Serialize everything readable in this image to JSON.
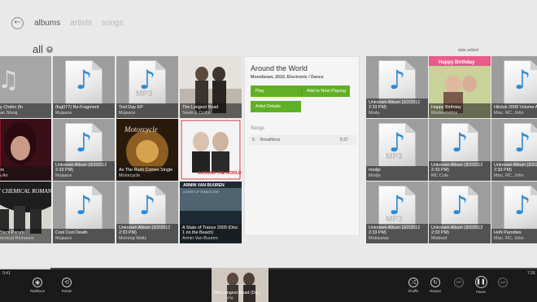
{
  "header": {
    "tabs": [
      {
        "label": "albums",
        "active": true
      },
      {
        "label": "artists",
        "active": false
      },
      {
        "label": "songs",
        "active": false
      }
    ],
    "filter": "all",
    "sort_label": "date added"
  },
  "tiles_left": [
    {
      "title": "...say Chaho (fo",
      "artist": "...Jaan Sheaj",
      "style": "faded"
    },
    {
      "title": "(fug077) Re-Fragment",
      "artist": "Mujaace",
      "style": "doc"
    },
    {
      "title": "Tool Day EP",
      "artist": "Mujaace",
      "style": "doc-mp3"
    },
    {
      "title": "The Longest Road",
      "artist": "Seals & Crofts",
      "style": "art-longest-road"
    },
    {
      "title": "...bers",
      "artist": "...dia Arr",
      "style": "art-portrait"
    },
    {
      "title": "Unknown Album (3/2/2012 2:33 PM)",
      "artist": "Mujaace",
      "style": "doc"
    },
    {
      "title": "As The Rush Comes Single",
      "artist": "Motorcycle",
      "style": "art-motorcycle"
    },
    {
      "title": "",
      "artist": "",
      "style": "art-aroundtheworld"
    },
    {
      "title": "...e Black Parade",
      "artist": "...Chemical Romance",
      "style": "art-mcr"
    },
    {
      "title": "Cool Cool Death",
      "artist": "Mujaace",
      "style": "doc"
    },
    {
      "title": "Unknown Album (3/2/2012 2:33 PM)",
      "artist": "Morning Waltz",
      "style": "doc"
    },
    {
      "title": "A State of Trance 2009 (Disc 1 on the Beach)",
      "artist": "Armin Van Buuren",
      "style": "art-armin"
    }
  ],
  "art_texts": {
    "motorcycle_logo": "Motorcycle",
    "around_the_world": "AROUND THE WORLD",
    "mcr_logo": "MY CHEMICAL ROMANCE",
    "armin_name": "ARMIN VAN BUUREN",
    "armin_sub": "A STATE OF TRANCE 2009",
    "birthday_banner": "Happy Birthday"
  },
  "detail": {
    "title": "Around the World",
    "meta": "Moonbeam, 2010, Electronic / Dance",
    "play_label": "Play",
    "add_label": "Add to Now Playing",
    "artist_details_label": "Artist Details",
    "songs_label": "Songs",
    "songs": [
      {
        "num": "5.",
        "name": "Breathless",
        "duration": "5:37"
      }
    ]
  },
  "tiles_right": [
    {
      "title": "Unknown Album (3/2/2012 2:33 PM)",
      "artist": "Modu",
      "style": "doc"
    },
    {
      "title": "Happy Birthday",
      "artist": "Modeselektor",
      "style": "art-birthday"
    },
    {
      "title": "Hitclub 2008 Volume A",
      "artist": "Misc. RC, John",
      "style": "doc"
    },
    {
      "title": "modjo",
      "artist": "Modjo",
      "style": "doc-mp3"
    },
    {
      "title": "Unknown Album (3/2/2012 2:33 PM)",
      "artist": "MC Cole",
      "style": "doc"
    },
    {
      "title": "Unknown Album (3/2/2012 2:33 PM)",
      "artist": "Misc. RC, John",
      "style": "doc"
    },
    {
      "title": "Unknown Album (3/2/2012 2:33 PM)",
      "artist": "Mobiustep",
      "style": "doc-mp3"
    },
    {
      "title": "Unknown Album (3/2/2012 2:33 PM)",
      "artist": "Misbred",
      "style": "doc"
    },
    {
      "title": "HoN Parodies",
      "artist": "Misc. RC, John",
      "style": "doc"
    }
  ],
  "player": {
    "elapsed": "0:41",
    "total": "7:26",
    "progress_fraction": 0.094,
    "left_buttons": [
      {
        "label": "Radbrace",
        "icon": "◉"
      },
      {
        "label": "Rotate",
        "icon": "⟲"
      }
    ],
    "now_playing_title": "The Longest Road (Da...",
    "now_playing_sub": "Now Playing",
    "right_buttons": [
      {
        "label": "Shuffle",
        "icon": "⤮",
        "enabled": true
      },
      {
        "label": "Repeat",
        "icon": "↻",
        "enabled": true
      },
      {
        "label": "",
        "icon": "⏮",
        "enabled": false
      },
      {
        "label": "Pause",
        "icon": "❚❚",
        "enabled": true
      },
      {
        "label": "",
        "icon": "⏭",
        "enabled": false
      }
    ]
  }
}
